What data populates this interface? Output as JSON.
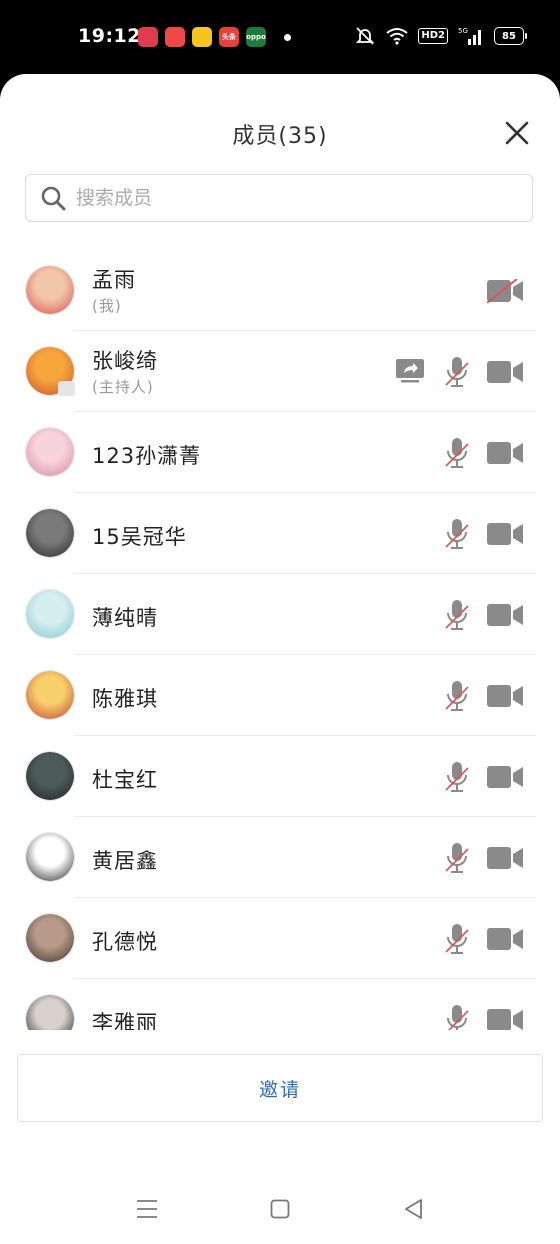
{
  "status_bar": {
    "time": "19:12",
    "apps": [
      {
        "icon": "heart-app-icon",
        "color": "#e23b4b",
        "label": ""
      },
      {
        "icon": "play-app-icon",
        "color": "#f04848",
        "label": ""
      },
      {
        "icon": "weibo-icon",
        "color": "#f4c51c",
        "label": ""
      },
      {
        "icon": "toutiao-icon",
        "color": "#e8403a",
        "label": "头条"
      },
      {
        "icon": "oppo-icon",
        "color": "#1d7c3a",
        "label": "oppo"
      }
    ],
    "network": "5G",
    "hd_label": "HD2",
    "battery": "85"
  },
  "header": {
    "title": "成员(35)"
  },
  "search": {
    "placeholder": "搜索成员",
    "value": ""
  },
  "members": [
    {
      "name": "孟雨",
      "sub": "(我)",
      "avatar_colors": [
        "#f2c6a8",
        "#d84f4f"
      ],
      "show_share": false,
      "show_mic": false,
      "camera_muted": true
    },
    {
      "name": "张峻绮",
      "sub": "(主持人)",
      "avatar_colors": [
        "#f6a63c",
        "#c9502e"
      ],
      "show_share": true,
      "show_mic": true,
      "camera_muted": false,
      "host": true
    },
    {
      "name": "123孙潇菁",
      "sub": "",
      "avatar_colors": [
        "#f7d3dc",
        "#d9879a"
      ],
      "show_share": false,
      "show_mic": true,
      "camera_muted": false
    },
    {
      "name": "15吴冠华",
      "sub": "",
      "avatar_colors": [
        "#7a7a7a",
        "#2a2a2a"
      ],
      "show_share": false,
      "show_mic": true,
      "camera_muted": false
    },
    {
      "name": "薄纯晴",
      "sub": "",
      "avatar_colors": [
        "#d7eef0",
        "#7ec7cf"
      ],
      "show_share": false,
      "show_mic": true,
      "camera_muted": false
    },
    {
      "name": "陈雅琪",
      "sub": "",
      "avatar_colors": [
        "#f7cf6b",
        "#c3402e"
      ],
      "show_share": false,
      "show_mic": true,
      "camera_muted": false
    },
    {
      "name": "杜宝红",
      "sub": "",
      "avatar_colors": [
        "#4d5c5a",
        "#1e2423"
      ],
      "show_share": false,
      "show_mic": true,
      "camera_muted": false
    },
    {
      "name": "黄居鑫",
      "sub": "",
      "avatar_colors": [
        "#ffffff",
        "#222222"
      ],
      "show_share": false,
      "show_mic": true,
      "camera_muted": false
    },
    {
      "name": "孔德悦",
      "sub": "",
      "avatar_colors": [
        "#b89a88",
        "#3d2f2a"
      ],
      "show_share": false,
      "show_mic": true,
      "camera_muted": false
    },
    {
      "name": "李雅丽",
      "sub": "",
      "avatar_colors": [
        "#d9d2cc",
        "#1a1a1a"
      ],
      "show_share": false,
      "show_mic": true,
      "camera_muted": false
    }
  ],
  "invite": {
    "label": "邀请"
  }
}
